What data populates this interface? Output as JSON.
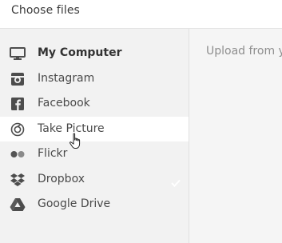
{
  "header": {
    "title": "Choose files"
  },
  "sidebar": {
    "items": [
      {
        "label": "My Computer",
        "icon": "computer-icon",
        "active": true
      },
      {
        "label": "Instagram",
        "icon": "instagram-icon"
      },
      {
        "label": "Facebook",
        "icon": "facebook-icon"
      },
      {
        "label": "Take Picture",
        "icon": "camera-icon",
        "hovered": true
      },
      {
        "label": "Flickr",
        "icon": "flickr-icon"
      },
      {
        "label": "Dropbox",
        "icon": "dropbox-icon"
      },
      {
        "label": "Google Drive",
        "icon": "google-drive-icon"
      }
    ]
  },
  "main": {
    "upload_text": "Upload from y"
  },
  "colors": {
    "sidebar_bg": "#f2f2f2",
    "icon": "#4d4d4d",
    "text": "#4a4a4a",
    "muted_text": "#8e8e8e"
  }
}
